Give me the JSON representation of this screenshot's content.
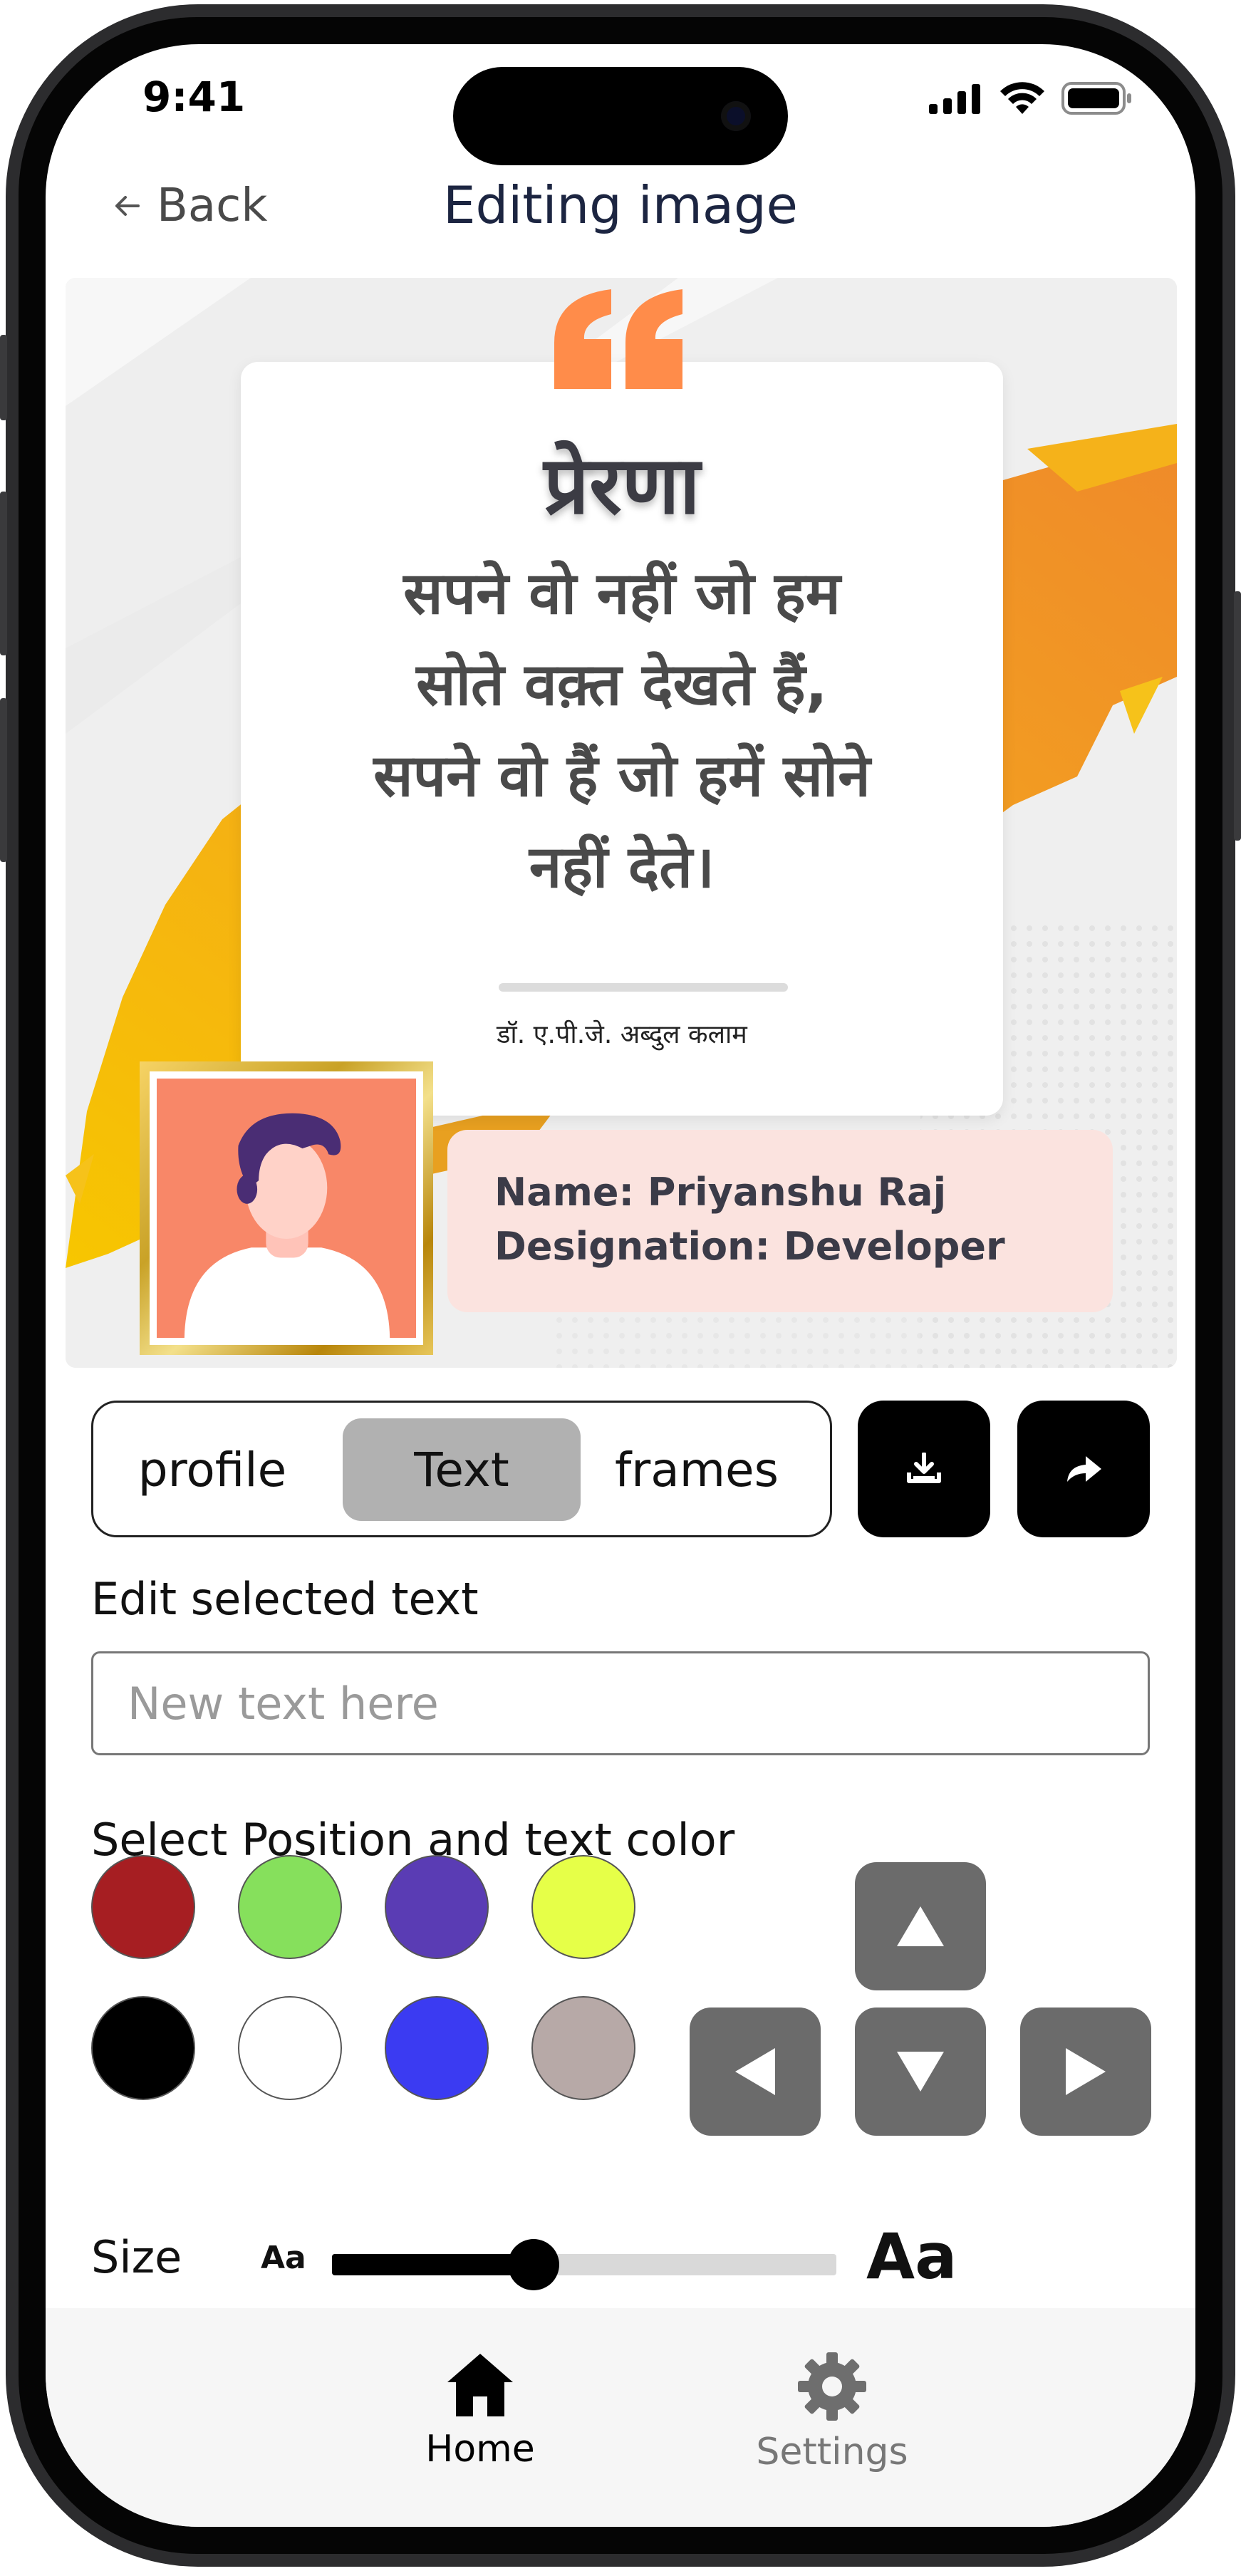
{
  "status_bar": {
    "time": "9:41"
  },
  "header": {
    "back_label": "Back",
    "title": "Editing image"
  },
  "poster": {
    "heading": "प्रेरणा",
    "quote_lines": [
      "सपने वो नहीं जो हम",
      "सोते वक़्त देखते हैं,",
      "सपने वो हैं जो हमें सोने",
      "नहीं देते।"
    ],
    "author": "डॉ. ए.पी.जे. अब्दुल कलाम",
    "name_line": "Name: Priyanshu Raj",
    "designation_line": "Designation: Developer"
  },
  "editor": {
    "tabs": [
      {
        "label": "profile",
        "active": false
      },
      {
        "label": "Text",
        "active": true
      },
      {
        "label": "frames",
        "active": false
      }
    ],
    "download_icon": "download-icon",
    "share_icon": "share-icon",
    "edit_text_label": "Edit selected text",
    "text_input": {
      "value": "",
      "placeholder": "New text here"
    },
    "position_color_label": "Select Position and text color",
    "colors": [
      "#a61e22",
      "#86e05c",
      "#5a3cb4",
      "#e6ff48",
      "#000000",
      "#ffffff",
      "#3b3bf2",
      "#b7a9a7"
    ],
    "arrows": [
      "up",
      "left",
      "down",
      "right"
    ],
    "size_label": "Size",
    "size_small": "Aa",
    "size_large": "Aa",
    "size_value": 0.4
  },
  "tab_bar": {
    "items": [
      {
        "label": "Home",
        "icon": "home-icon",
        "active": true
      },
      {
        "label": "Settings",
        "icon": "gear-icon",
        "active": false
      }
    ]
  }
}
